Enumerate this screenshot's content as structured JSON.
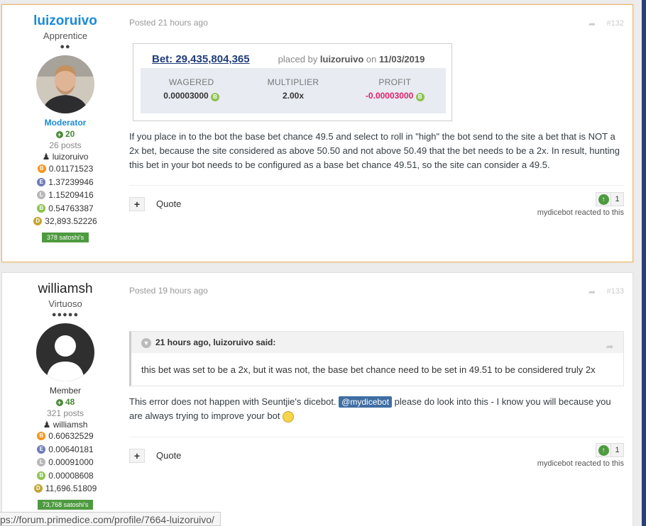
{
  "posts": [
    {
      "author": {
        "name": "luizoruivo",
        "rank": "Apprentice",
        "pips": "●●",
        "group": "Moderator",
        "reputation": "20",
        "post_count": "26 posts",
        "username_line": "luizoruivo",
        "balances": [
          {
            "coin": "bitcoin",
            "color": "#f7931a",
            "amount": "0.01171523"
          },
          {
            "coin": "ethereum",
            "color": "#6f7cba",
            "amount": "1.37239946"
          },
          {
            "coin": "litecoin",
            "color": "#b8b8b8",
            "amount": "1.15209416"
          },
          {
            "coin": "bitcoincash",
            "color": "#8dc351",
            "amount": "0.54763387"
          },
          {
            "coin": "dogecoin",
            "color": "#c2a633",
            "amount": "32,893.52226"
          }
        ],
        "satoshis": "378 satoshi's"
      },
      "posted": "Posted 21 hours ago",
      "post_number": "#132",
      "bet": {
        "title": "Bet: 29,435,804,365",
        "placed_prefix": "placed by",
        "placed_by": "luizoruivo",
        "placed_on_prefix": "on",
        "placed_date": "11/03/2019",
        "wagered_label": "WAGERED",
        "wagered": "0.00003000",
        "multiplier_label": "MULTIPLIER",
        "multiplier": "2.00x",
        "profit_label": "PROFIT",
        "profit": "-0.00003000"
      },
      "body": "If you place in to the bot the base bet chance 49.5 and select to roll in \"high\" the bot send to the site a bet that is NOT a 2x bet, because the site considered as above 50.50 and not above 50.49 that the bet needs to be a 2x. In result, hunting this bet in your bot needs to be configured as a base bet chance 49.51, so the site can consider a 49.5.",
      "quote_label": "Quote",
      "reaction_count": "1",
      "reacted_by": "mydicebot reacted to this"
    },
    {
      "author": {
        "name": "williamsh",
        "rank": "Virtuoso",
        "pips": "●●●●●",
        "group": "Member",
        "reputation": "48",
        "post_count": "321 posts",
        "username_line": "williamsh",
        "balances": [
          {
            "coin": "bitcoin",
            "color": "#f7931a",
            "amount": "0.60632529"
          },
          {
            "coin": "ethereum",
            "color": "#6f7cba",
            "amount": "0.00640181"
          },
          {
            "coin": "litecoin",
            "color": "#b8b8b8",
            "amount": "0.00091000"
          },
          {
            "coin": "bitcoincash",
            "color": "#8dc351",
            "amount": "0.00008608"
          },
          {
            "coin": "dogecoin",
            "color": "#c2a633",
            "amount": "11,696.51809"
          }
        ],
        "satoshis": "73,768 satoshi's"
      },
      "posted": "Posted 19 hours ago",
      "post_number": "#133",
      "quote": {
        "header": "21 hours ago, luizoruivo said:",
        "text": "this bet was set to be a 2x, but it was not, the base bet chance need to be set in 49.51 to be considered truly 2x"
      },
      "body_before": "This error does not happen with Seuntjie's dicebot.",
      "mention": "@mydicebot",
      "body_after": "please do look into this - I know you will because you are always trying to improve your bot",
      "quote_label": "Quote",
      "reaction_count": "1",
      "reacted_by": "mydicebot reacted to this"
    }
  ],
  "status_url": "ps://forum.primedice.com/profile/7664-luizoruivo/"
}
